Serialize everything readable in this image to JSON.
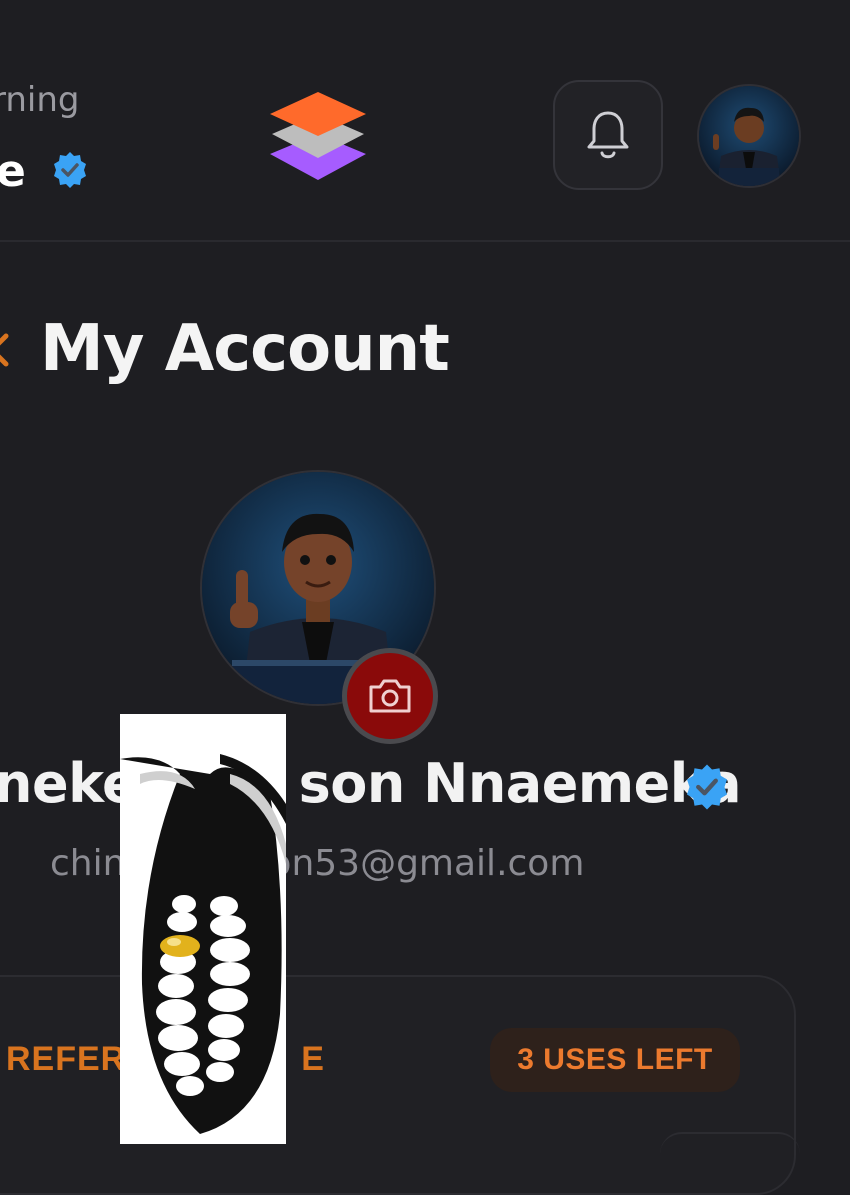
{
  "header": {
    "greeting": "rning",
    "user_name": "e",
    "verified_icon": "verified-badge-icon",
    "logo_icon": "layers-logo-icon",
    "notification_icon": "bell-icon",
    "colors": {
      "logo_top": "#ff6a2b",
      "logo_mid": "#bdbdbd",
      "logo_bottom": "#a65cff",
      "verified": "#3aa3f5"
    }
  },
  "page": {
    "back_icon": "chevron-left-icon",
    "title": "My Account"
  },
  "profile": {
    "avatar_icon": "cartoon-avatar-image",
    "camera_icon": "camera-icon",
    "name": "neke   son Nnaemeka",
    "email": "chin    on53@gmail.com",
    "camera_button_color": "#8a0a0a"
  },
  "referral": {
    "label": "REFER     E",
    "uses_left": "3 USES LEFT",
    "accent_color": "#ec7a2e"
  },
  "overlay": {
    "sticker_icon": "grinning-mouth-sticker"
  }
}
